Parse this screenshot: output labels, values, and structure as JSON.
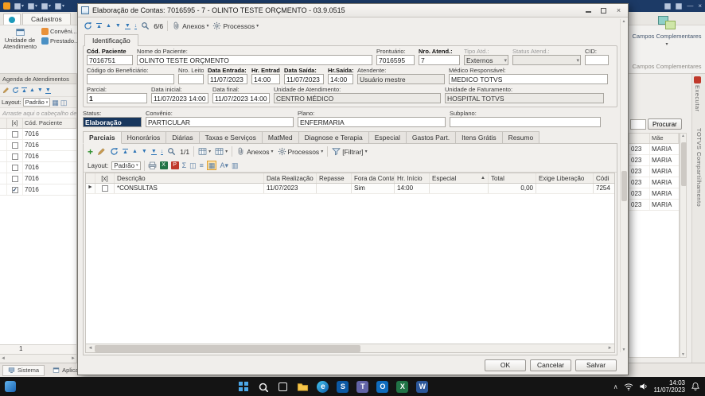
{
  "app": {
    "ribbon_tab": "Cadastros",
    "ribbon_buttons": {
      "unidade_atendimento": "Unidade de Atendimento",
      "convenios": "Convêni...",
      "prestadores": "Prestado..."
    },
    "campos_complementares_button": "Campos Complementares",
    "campos_complementares_group": "Campos Complementares"
  },
  "left_panel": {
    "title": "Agenda de Atendimentos",
    "layout_label": "Layout:",
    "layout_value": "Padrão",
    "drag_hint": "Arraste aqui o cabeçalho de",
    "grid": {
      "col_check": "[x]",
      "col_code": "Cód. Paciente",
      "rows": [
        {
          "code": "7016"
        },
        {
          "code": "7016"
        },
        {
          "code": "7016"
        },
        {
          "code": "7016"
        },
        {
          "code": "7016"
        },
        {
          "code": "7016"
        }
      ],
      "count": "1"
    },
    "bottom_tabs": {
      "sistema": "Sistema",
      "aplicacao": "Aplicação"
    }
  },
  "right_panel": {
    "search_button": "Procurar",
    "grid": {
      "col_mae": "Mãe",
      "rows": [
        {
          "date": "023",
          "mae": "MARIA"
        },
        {
          "date": "023",
          "mae": "MARIA"
        },
        {
          "date": "023",
          "mae": "MARIA"
        },
        {
          "date": "023",
          "mae": "MARIA"
        },
        {
          "date": "023",
          "mae": "MARIA"
        },
        {
          "date": "023",
          "mae": "MARIA"
        }
      ]
    },
    "vertical_tabs": {
      "executar": "Executar",
      "compartilhamento": "TOTVS Compartilhamento"
    }
  },
  "dialog": {
    "title": "Elaboração de Contas: 7016595 - 7 - OLINTO TESTE ORÇMENTO - 03.9.0515",
    "toolbar": {
      "pager": "6/6",
      "anexos": "Anexos",
      "processos": "Processos"
    },
    "id_tab": "Identificação",
    "fields": {
      "cod_paciente": {
        "label": "Cód. Paciente",
        "value": "7016751"
      },
      "nome_paciente": {
        "label": "Nome do Paciente:",
        "value": "OLINTO TESTE ORÇMENTO"
      },
      "prontuario": {
        "label": "Prontuário:",
        "value": "7016595"
      },
      "nro_atend": {
        "label": "Nro. Atend.:",
        "value": "7"
      },
      "tipo_atd": {
        "label": "Tipo Atd.:",
        "value": "Externos"
      },
      "status_atend": {
        "label": "Status Atend.:",
        "value": ""
      },
      "cid": {
        "label": "CID:",
        "value": ""
      },
      "cod_beneficiario": {
        "label": "Código do Beneficiário:",
        "value": ""
      },
      "nro_leito": {
        "label": "Nro. Leito:",
        "value": ""
      },
      "data_entrada": {
        "label": "Data Entrada:",
        "value": "11/07/2023"
      },
      "hr_entrada": {
        "label": "Hr. Entrada:",
        "value": "14:00"
      },
      "data_saida": {
        "label": "Data Saída:",
        "value": "11/07/2023"
      },
      "hr_saida": {
        "label": "Hr.Saída:",
        "value": "14:00"
      },
      "atendente": {
        "label": "Atendente:",
        "value": "Usuário mestre"
      },
      "medico_responsavel": {
        "label": "Médico Responsável:",
        "value": "MEDICO TOTVS"
      },
      "parcial": {
        "label": "Parcial:",
        "value": "1"
      },
      "data_inicial": {
        "label": "Data inicial:",
        "value": "11/07/2023 14:00:00"
      },
      "data_final": {
        "label": "Data final:",
        "value": "11/07/2023 14:00:00"
      },
      "unidade_atendimento": {
        "label": "Unidade de Atendimento:",
        "value": "CENTRO MÉDICO"
      },
      "unidade_faturamento": {
        "label": "Unidade de Faturamento:",
        "value": "HOSPITAL TOTVS"
      },
      "status": {
        "label": "Status:",
        "value": "Elaboração"
      },
      "convenio": {
        "label": "Convênio:",
        "value": "PARTICULAR"
      },
      "plano": {
        "label": "Plano:",
        "value": "ENFERMARIA"
      },
      "subplano": {
        "label": "Subplano:",
        "value": ""
      }
    },
    "tabs": [
      "Parciais",
      "Honorários",
      "Diárias",
      "Taxas e Serviços",
      "MatMed",
      "Diagnose e Terapia",
      "Especial",
      "Gastos Part.",
      "Itens Grátis",
      "Resumo"
    ],
    "parciais": {
      "pager": "1/1",
      "anexos": "Anexos",
      "processos": "Processos",
      "filtrar": "[Filtrar]",
      "layout_label": "Layout:",
      "layout_value": "Padrão",
      "grid": {
        "columns": {
          "check": "[x]",
          "descricao": "Descrição",
          "data_realizacao": "Data Realização",
          "repasse": "Repasse",
          "fora_conta": "Fora da Conta",
          "hr_inicio": "Hr. Início",
          "especial": "Especial",
          "total": "Total",
          "exige_liberacao": "Exige Liberação",
          "codigo": "Códi"
        },
        "rows": [
          {
            "descricao": "*CONSULTAS",
            "data_realizacao": "11/07/2023",
            "repasse": "",
            "fora_conta": "Sim",
            "hr_inicio": "14:00",
            "especial": "",
            "total": "0,00",
            "exige_liberacao": "",
            "codigo": "7254"
          }
        ]
      }
    },
    "buttons": {
      "ok": "OK",
      "cancelar": "Cancelar",
      "salvar": "Salvar"
    }
  },
  "taskbar": {
    "tray": {
      "time": "14:03",
      "date": "11/07/2023"
    }
  },
  "icons": {
    "refresh": "circular-arrows",
    "search": "magnifier",
    "attachment": "paperclip",
    "processes": "gear",
    "filter": "funnel",
    "edit": "pencil",
    "add": "plus",
    "nav": "record-navigation-arrows",
    "export": "table-grid"
  }
}
